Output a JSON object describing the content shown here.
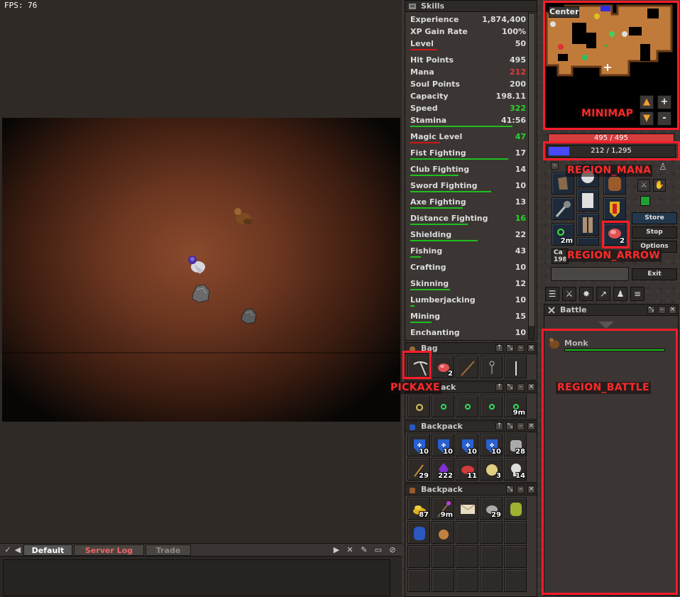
{
  "fps": "FPS: 76",
  "chat": {
    "tabs": [
      "Default",
      "Server Log",
      "Trade"
    ]
  },
  "skills": {
    "title": "Skills",
    "rows": [
      {
        "name": "Experience",
        "value": "1,874,400",
        "color": "#dcdcdc"
      },
      {
        "name": "XP Gain Rate",
        "value": "100%",
        "color": "#dcdcdc"
      },
      {
        "name": "Level",
        "value": "50",
        "color": "#dcdcdc",
        "bar": "red",
        "progress": 0.25
      },
      {
        "name": "Hit Points",
        "value": "495",
        "color": "#dcdcdc"
      },
      {
        "name": "Mana",
        "value": "212",
        "color": "#e23b3b"
      },
      {
        "name": "Soul Points",
        "value": "200",
        "color": "#dcdcdc"
      },
      {
        "name": "Capacity",
        "value": "198.11",
        "color": "#dcdcdc"
      },
      {
        "name": "Speed",
        "value": "322",
        "color": "#2bd12b"
      },
      {
        "name": "Stamina",
        "value": "41:56",
        "color": "#dcdcdc",
        "bar": "green",
        "progress": 0.96
      },
      {
        "name": "Magic Level",
        "value": "47",
        "color": "#2bd12b",
        "bar": "red",
        "progress": 0.28
      },
      {
        "name": "Fist Fighting",
        "value": "17",
        "color": "#dcdcdc",
        "bar": "green",
        "progress": 0.92
      },
      {
        "name": "Club Fighting",
        "value": "14",
        "color": "#dcdcdc",
        "bar": "green",
        "progress": 0.45
      },
      {
        "name": "Sword Fighting",
        "value": "10",
        "color": "#dcdcdc",
        "bar": "green",
        "progress": 0.76
      },
      {
        "name": "Axe Fighting",
        "value": "13",
        "color": "#dcdcdc",
        "bar": "green",
        "progress": 0.49
      },
      {
        "name": "Distance Fighting",
        "value": "16",
        "color": "#2bd12b",
        "bar": "green",
        "progress": 0.54
      },
      {
        "name": "Shielding",
        "value": "22",
        "color": "#dcdcdc",
        "bar": "green",
        "progress": 0.63
      },
      {
        "name": "Fishing",
        "value": "43",
        "color": "#dcdcdc",
        "bar": "green",
        "progress": 0.1
      },
      {
        "name": "Crafting",
        "value": "10",
        "color": "#dcdcdc"
      },
      {
        "name": "Skinning",
        "value": "12",
        "color": "#dcdcdc",
        "bar": "green",
        "progress": 0.37
      },
      {
        "name": "Lumberjacking",
        "value": "10",
        "color": "#dcdcdc",
        "bar": "green",
        "progress": 0.04
      },
      {
        "name": "Mining",
        "value": "15",
        "color": "#dcdcdc",
        "bar": "green",
        "progress": 0.2
      },
      {
        "name": "Enchanting",
        "value": "10",
        "color": "#dcdcdc"
      }
    ]
  },
  "bag": {
    "title": "Bag",
    "items": [
      {
        "icon": "pickaxe-icon",
        "count": ""
      },
      {
        "icon": "meat-icon",
        "count": "2"
      },
      {
        "icon": "fishing-rod-icon",
        "count": ""
      },
      {
        "icon": "key-icon",
        "count": ""
      },
      {
        "icon": "knife-icon",
        "count": ""
      }
    ]
  },
  "backpack1": {
    "title": "ack",
    "items": [
      {
        "icon": "amulet-icon",
        "count": ""
      },
      {
        "icon": "ring-icon",
        "count": ""
      },
      {
        "icon": "ring-icon",
        "count": ""
      },
      {
        "icon": "ring-icon",
        "count": ""
      },
      {
        "icon": "ring-icon",
        "count": "9m"
      }
    ]
  },
  "backpack2": {
    "title": "Backpack",
    "items": [
      {
        "icon": "blue-shield-icon",
        "count": "10"
      },
      {
        "icon": "blue-shield-icon",
        "count": "10"
      },
      {
        "icon": "blue-shield-icon",
        "count": "10"
      },
      {
        "icon": "blue-shield-icon",
        "count": "10"
      },
      {
        "icon": "rune-icon",
        "count": "28"
      },
      {
        "icon": "wand-icon",
        "count": "29"
      },
      {
        "icon": "purple-gem-icon",
        "count": "222"
      },
      {
        "icon": "red-meat-icon",
        "count": "11"
      },
      {
        "icon": "cheese-icon",
        "count": "3"
      },
      {
        "icon": "skull-icon",
        "count": "14"
      }
    ]
  },
  "backpack3": {
    "title": "Backpack",
    "items": [
      {
        "icon": "gold-coins-icon",
        "count": "87"
      },
      {
        "icon": "staff-icon",
        "count": "9m"
      },
      {
        "icon": "letter-icon",
        "count": ""
      },
      {
        "icon": "stone-icon",
        "count": "29"
      },
      {
        "icon": "green-backpack-icon",
        "count": ""
      },
      {
        "icon": "blue-backpack-icon",
        "count": ""
      },
      {
        "icon": "pouch-icon",
        "count": ""
      }
    ]
  },
  "minimap": {
    "center_label": "Center",
    "zoom_in": "+",
    "zoom_out": "-"
  },
  "status": {
    "hp_text": "495 / 495",
    "hp_fraction": 1.0,
    "mana_text": "212 / 1,295",
    "mana_fraction": 0.164
  },
  "inventory": {
    "arrow_count": "2",
    "ring_time": "2m",
    "cap_label": "Ca",
    "cap_value": "198",
    "buttons": [
      "Store",
      "Stop",
      "Options",
      "Exit"
    ]
  },
  "battle": {
    "title": "Battle",
    "entries": [
      {
        "name": "Monk",
        "hp_fraction": 1.0
      }
    ]
  },
  "annotations": {
    "minimap": "MINIMAP",
    "mana": "REGION_MANA",
    "arrow": "REGION_ARROW",
    "pickaxe": "PICKAXE",
    "battle": "REGION_BATTLE"
  }
}
